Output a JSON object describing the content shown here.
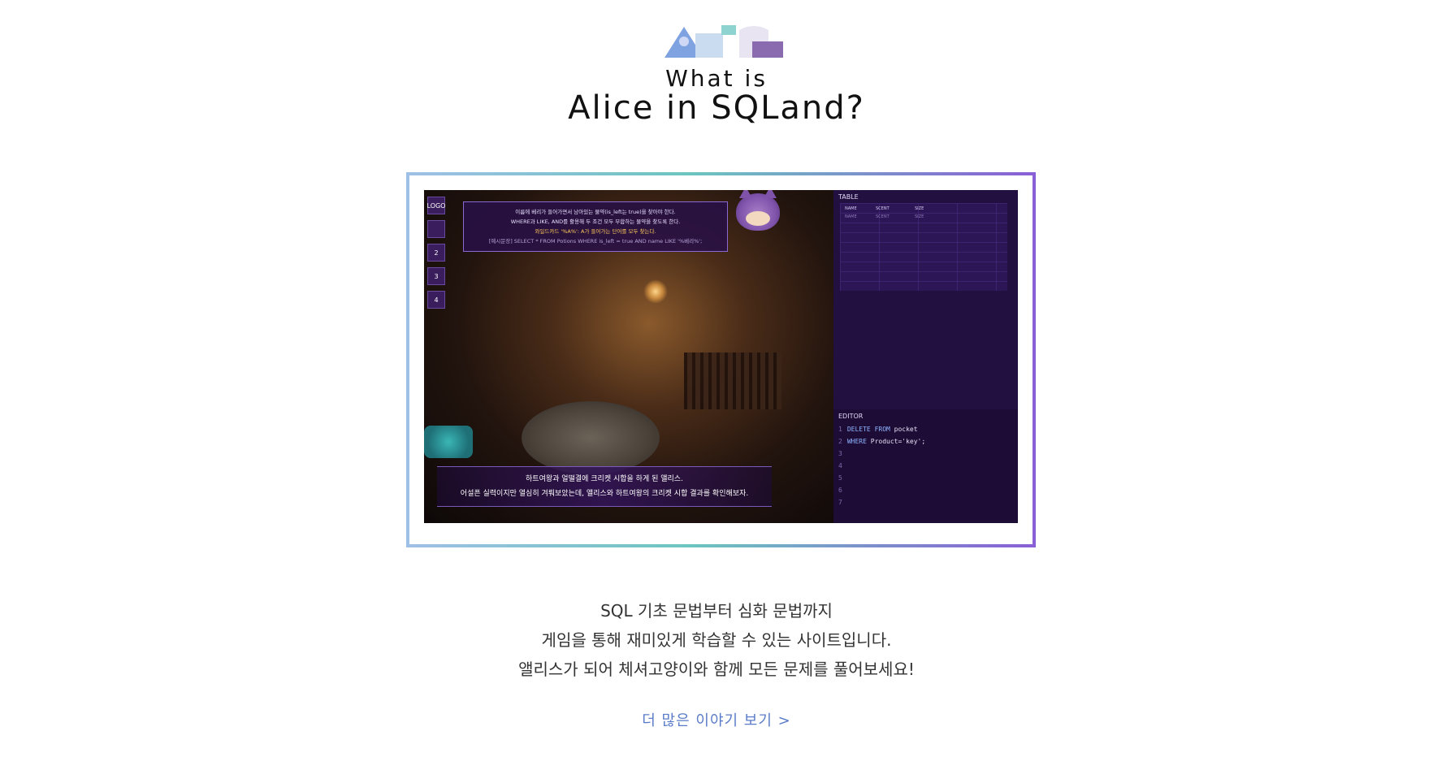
{
  "header": {
    "logo_icon": "asc-logo",
    "small_title": "What is",
    "main_title": "Alice in SQLand?"
  },
  "screenshot": {
    "left_nav": [
      "LOGO",
      "",
      "2",
      "3",
      "4"
    ],
    "hint": {
      "line1": "이름에 베리가 들어가면서 남아있는 물약(is_left는 true)을 찾아야 한다.",
      "line2": "WHERE과 LIKE, AND를 활용해 두 조건 모두 부합하는 물약을 찾도록 한다.",
      "line3": "와일드카드 '%A%': A가 들어가는 단어를 모두 찾는다.",
      "line4": "[예시문장] SELECT * FROM Potions WHERE is_left = true AND name LIKE '%베리%';"
    },
    "subtitle": {
      "line1": "하트여왕과 얼떨결에 크리켓 시합을 하게 된 앨리스.",
      "line2": "어설픈 실력이지만 열심히 겨뤄보았는데, 앨리스와 하트여왕의 크리켓 시합 결과를 확인해보자."
    },
    "table_panel": {
      "label": "TABLE",
      "headers": [
        "NAME",
        "SCENT",
        "SIZE"
      ],
      "row": [
        "NAME",
        "SCENT",
        "SIZE"
      ]
    },
    "editor_panel": {
      "label": "EDITOR",
      "lines": [
        {
          "num": "1",
          "kw": "DELETE",
          "rest_kw": "FROM",
          "rest": "pocket"
        },
        {
          "num": "2",
          "kw": "WHERE",
          "rest_kw": "",
          "rest": "Product='key';"
        },
        {
          "num": "3",
          "kw": "",
          "rest_kw": "",
          "rest": ""
        },
        {
          "num": "4",
          "kw": "",
          "rest_kw": "",
          "rest": ""
        },
        {
          "num": "5",
          "kw": "",
          "rest_kw": "",
          "rest": ""
        },
        {
          "num": "6",
          "kw": "",
          "rest_kw": "",
          "rest": ""
        },
        {
          "num": "7",
          "kw": "",
          "rest_kw": "",
          "rest": ""
        }
      ]
    }
  },
  "description": {
    "line1": "SQL 기초 문법부터 심화 문법까지",
    "line2": "게임을 통해 재미있게 학습할 수 있는 사이트입니다.",
    "line3": "앨리스가 되어 체셔고양이와 함께 모든 문제를 풀어보세요!"
  },
  "more_link": "더 많은 이야기 보기 >",
  "colors": {
    "link": "#5a7cc8",
    "frame_gradient_start": "#9fc0e6",
    "frame_gradient_mid": "#6cc5c0",
    "frame_gradient_end": "#8a5fd6"
  }
}
